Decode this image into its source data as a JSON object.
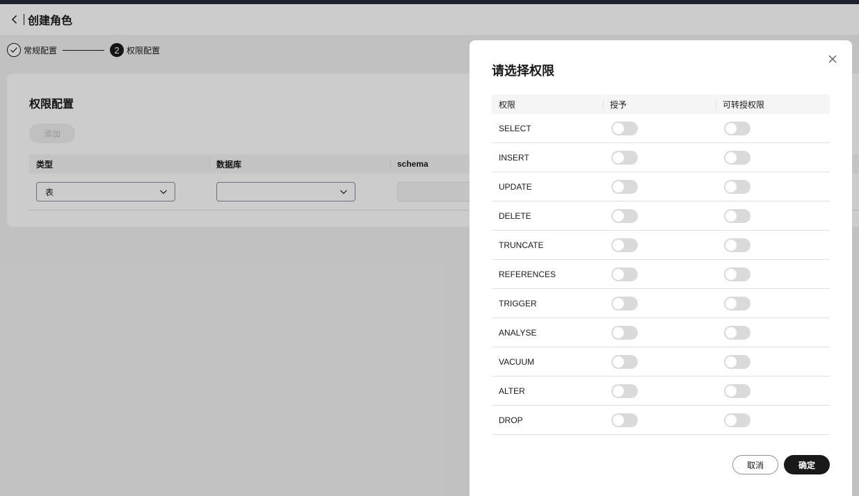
{
  "header": {
    "title": "创建角色",
    "back_icon": "chevron-left-icon"
  },
  "steps": [
    {
      "label": "常规配置",
      "status": "done"
    },
    {
      "label": "权限配置",
      "number": "2",
      "status": "active"
    }
  ],
  "config": {
    "title": "权限配置",
    "add_label": "添加",
    "columns": [
      "类型",
      "数据库",
      "schema"
    ],
    "row": {
      "type_value": "表",
      "database_value": "",
      "schema_value": ""
    }
  },
  "dialog": {
    "title": "请选择权限",
    "columns": [
      "权限",
      "授予",
      "可转授权限"
    ],
    "permissions": [
      {
        "name": "SELECT",
        "grant": false,
        "grantable": false
      },
      {
        "name": "INSERT",
        "grant": false,
        "grantable": false
      },
      {
        "name": "UPDATE",
        "grant": false,
        "grantable": false
      },
      {
        "name": "DELETE",
        "grant": false,
        "grantable": false
      },
      {
        "name": "TRUNCATE",
        "grant": false,
        "grantable": false
      },
      {
        "name": "REFERENCES",
        "grant": false,
        "grantable": false
      },
      {
        "name": "TRIGGER",
        "grant": false,
        "grantable": false
      },
      {
        "name": "ANALYSE",
        "grant": false,
        "grantable": false
      },
      {
        "name": "VACUUM",
        "grant": false,
        "grantable": false
      },
      {
        "name": "ALTER",
        "grant": false,
        "grantable": false
      },
      {
        "name": "DROP",
        "grant": false,
        "grantable": false
      }
    ],
    "cancel_label": "取消",
    "ok_label": "确定"
  },
  "colors": {
    "primary": "#191919",
    "switch_off": "#dadada",
    "mask": "rgba(0,0,0,0.2)"
  }
}
